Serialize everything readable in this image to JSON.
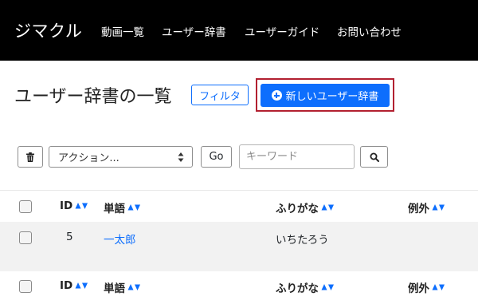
{
  "navbar": {
    "brand": "ジマクル",
    "links": [
      "動画一覧",
      "ユーザー辞書",
      "ユーザーガイド",
      "お問い合わせ"
    ]
  },
  "page": {
    "title": "ユーザー辞書の一覧",
    "filter_button": "フィルタ",
    "add_button": "新しいユーザー辞書"
  },
  "toolbar": {
    "action_select": "アクション...",
    "go_button": "Go",
    "keyword_placeholder": "キーワード"
  },
  "table": {
    "columns": [
      "ID",
      "単語",
      "ふりがな",
      "例外"
    ],
    "rows": [
      {
        "id": "5",
        "word": "一太郎",
        "furigana": "いちたろう",
        "exception": ""
      }
    ]
  },
  "icons": {
    "trash": "trash-icon",
    "search": "search-icon",
    "add": "plus-circle-icon",
    "sort": "sort-arrows-icon",
    "select": "select-updown-icon"
  },
  "colors": {
    "navbar_bg": "#000000",
    "primary": "#0d6efd",
    "highlight": "#b22030",
    "row_bg": "#f2f2f2"
  }
}
